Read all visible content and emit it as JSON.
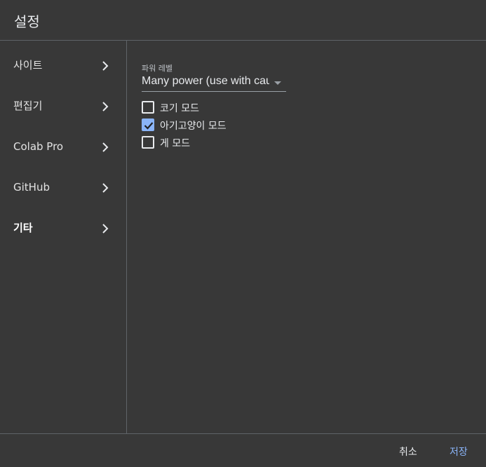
{
  "dialog": {
    "title": "설정"
  },
  "sidebar": {
    "items": [
      {
        "label": "사이트",
        "active": false
      },
      {
        "label": "편집기",
        "active": false
      },
      {
        "label": "Colab Pro",
        "active": false
      },
      {
        "label": "GitHub",
        "active": false
      },
      {
        "label": "기타",
        "active": true
      }
    ]
  },
  "content": {
    "power_level": {
      "label": "파워 레벨",
      "selected_value": "Many power (use with caution)"
    },
    "checkboxes": [
      {
        "label": "코기 모드",
        "checked": false
      },
      {
        "label": "아기고양이 모드",
        "checked": true
      },
      {
        "label": "게 모드",
        "checked": false
      }
    ]
  },
  "footer": {
    "cancel_label": "취소",
    "save_label": "저장"
  },
  "colors": {
    "accent": "#8ab4f8",
    "background": "#383838",
    "divider": "#5f6368"
  }
}
